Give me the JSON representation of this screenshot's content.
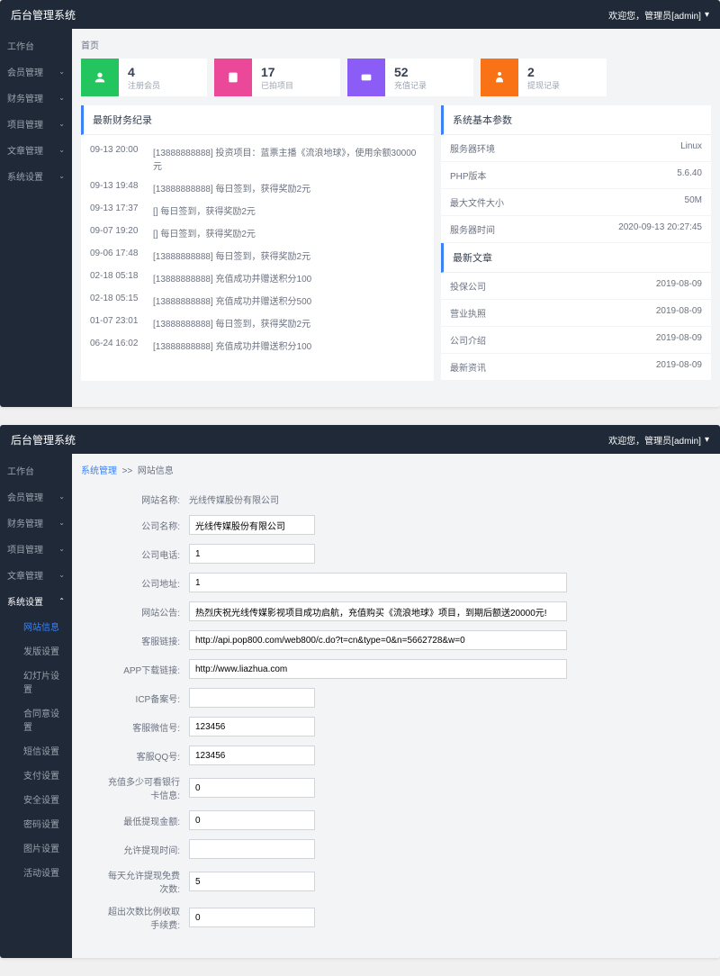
{
  "header": {
    "title": "后台管理系统",
    "welcome": "欢迎您，管理员[admin]"
  },
  "sidebar": {
    "items": [
      {
        "label": "工作台",
        "icon": "dashboard"
      },
      {
        "label": "会员管理",
        "icon": "users",
        "expandable": true
      },
      {
        "label": "财务管理",
        "icon": "money",
        "expandable": true
      },
      {
        "label": "项目管理",
        "icon": "box",
        "expandable": true
      },
      {
        "label": "文章管理",
        "icon": "doc",
        "expandable": true
      },
      {
        "label": "系统设置",
        "icon": "gear",
        "expandable": true
      }
    ],
    "system_sub": [
      "网站信息",
      "发版设置",
      "幻灯片设置",
      "合同意设置",
      "短信设置",
      "支付设置",
      "安全设置",
      "密码设置",
      "图片设置",
      "活动设置"
    ]
  },
  "screen1": {
    "breadcrumb": "首页",
    "stats": [
      {
        "value": "4",
        "label": "注册会员"
      },
      {
        "value": "17",
        "label": "已拍项目"
      },
      {
        "value": "52",
        "label": "充值记录"
      },
      {
        "value": "2",
        "label": "提现记录"
      }
    ],
    "finance_title": "最新财务纪录",
    "finance_logs": [
      {
        "time": "09-13 20:00",
        "text": "[13888888888] 投资项目：蓝票主播《流浪地球》，使用余额30000元"
      },
      {
        "time": "09-13 19:48",
        "text": "[13888888888] 每日签到，获得奖励2元"
      },
      {
        "time": "09-13 17:37",
        "text": "[] 每日签到，获得奖励2元"
      },
      {
        "time": "09-07 19:20",
        "text": "[] 每日签到，获得奖励2元"
      },
      {
        "time": "09-06 17:48",
        "text": "[13888888888] 每日签到，获得奖励2元"
      },
      {
        "time": "02-18 05:18",
        "text": "[13888888888] 充值成功并赠送积分100"
      },
      {
        "time": "02-18 05:15",
        "text": "[13888888888] 充值成功并赠送积分500"
      },
      {
        "time": "01-07 23:01",
        "text": "[13888888888] 每日签到，获得奖励2元"
      },
      {
        "time": "06-24 16:02",
        "text": "[13888888888] 充值成功并赠送积分100"
      }
    ],
    "params_title": "系统基本参数",
    "params": [
      {
        "k": "服务器环境",
        "v": "Linux"
      },
      {
        "k": "PHP版本",
        "v": "5.6.40"
      },
      {
        "k": "最大文件大小",
        "v": "50M"
      },
      {
        "k": "服务器时间",
        "v": "2020-09-13 20:27:45"
      }
    ],
    "articles_title": "最新文章",
    "articles": [
      {
        "k": "投保公司",
        "v": "2019-08-09"
      },
      {
        "k": "营业执照",
        "v": "2019-08-09"
      },
      {
        "k": "公司介绍",
        "v": "2019-08-09"
      },
      {
        "k": "最新资讯",
        "v": "2019-08-09"
      }
    ]
  },
  "screen2": {
    "breadcrumb_parent": "系统管理",
    "breadcrumb_sep": ">>",
    "breadcrumb_current": "网站信息",
    "form": {
      "site_name": {
        "label": "网站名称:",
        "value": "光线传媒股份有限公司"
      },
      "company_name": {
        "label": "公司名称:",
        "value": "光线传媒股份有限公司"
      },
      "company_phone": {
        "label": "公司电话:",
        "value": "1"
      },
      "company_addr": {
        "label": "公司地址:",
        "value": "1"
      },
      "site_notice": {
        "label": "网站公告:",
        "value": "热烈庆祝光线传媒影视项目成功启航，充值购买《流浪地球》项目，到期后额送20000元!"
      },
      "service_link": {
        "label": "客服链接:",
        "value": "http://api.pop800.com/web800/c.do?t=cn&type=0&n=5662728&w=0"
      },
      "app_link": {
        "label": "APP下载链接:",
        "value": "http://www.liazhua.com"
      },
      "icp": {
        "label": "ICP备案号:",
        "value": ""
      },
      "wechat": {
        "label": "客服微信号:",
        "value": "123456"
      },
      "qq": {
        "label": "客服QQ号:",
        "value": "123456"
      },
      "bank_min": {
        "label": "充值多少可看银行卡信息:",
        "value": "0"
      },
      "withdraw_min": {
        "label": "最低提现金额:",
        "value": "0"
      },
      "withdraw_time": {
        "label": "允许提现时间:",
        "value": ""
      },
      "free_times": {
        "label": "每天允许提现免费次数:",
        "value": "5"
      },
      "fee_rate": {
        "label": "超出次数比例收取手续费:",
        "value": "0"
      }
    }
  }
}
